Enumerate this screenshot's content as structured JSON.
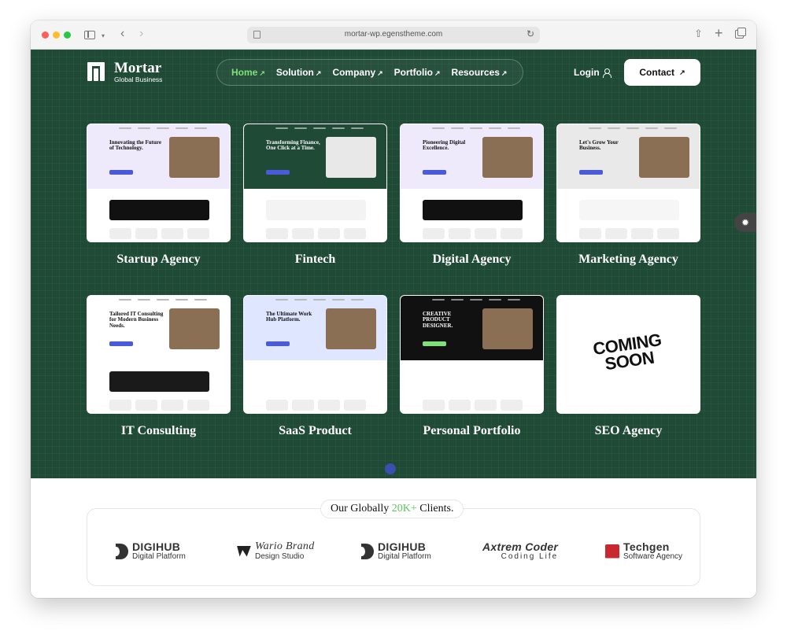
{
  "browser": {
    "url": "mortar-wp.egenstheme.com"
  },
  "brand": {
    "name": "Mortar",
    "tagline": "Global Business"
  },
  "nav": {
    "items": [
      {
        "label": "Home",
        "active": true
      },
      {
        "label": "Solution",
        "active": false
      },
      {
        "label": "Company",
        "active": false
      },
      {
        "label": "Portfolio",
        "active": false
      },
      {
        "label": "Resources",
        "active": false
      }
    ],
    "arrow_glyph": "↗",
    "login_label": "Login",
    "contact_label": "Contact"
  },
  "demos": [
    {
      "label": "Startup Agency",
      "headline": "Innovating the Future of Technology.",
      "theme": "light"
    },
    {
      "label": "Fintech",
      "headline": "Transforming Finance, One Click at a Time.",
      "theme": "dark"
    },
    {
      "label": "Digital Agency",
      "headline": "Pioneering Digital Excellence.",
      "theme": "light"
    },
    {
      "label": "Marketing Agency",
      "headline": "Let's Grow Your Business.",
      "theme": "gray"
    },
    {
      "label": "IT Consulting",
      "headline": "Tailored IT Consulting for Modern Business Needs.",
      "theme": "light-dark"
    },
    {
      "label": "SaaS Product",
      "headline": "The Ultimate Work Hub Platform.",
      "theme": "blue"
    },
    {
      "label": "Personal Portfolio",
      "headline": "CREATIVE PRODUCT DESIGNER.",
      "theme": "black"
    },
    {
      "label": "SEO Agency",
      "headline": "COMING SOON",
      "theme": "coming-soon"
    }
  ],
  "clients": {
    "title_prefix": "Our Globally ",
    "title_highlight": "20K+",
    "title_suffix": " Clients.",
    "logos": [
      {
        "name": "DIGIHUB",
        "sub": "Digital Platform"
      },
      {
        "name": "Wario Brand",
        "sub": "Design Studio"
      },
      {
        "name": "DIGIHUB",
        "sub": "Digital Platform"
      },
      {
        "name": "Axtrem Coder",
        "sub": "Coding Life"
      },
      {
        "name": "Techgen",
        "sub": "Software Agency"
      }
    ]
  },
  "colors": {
    "hero_bg": "#1f4a36",
    "accent_green": "#7fe07a",
    "highlight_green": "#5cc85a"
  }
}
